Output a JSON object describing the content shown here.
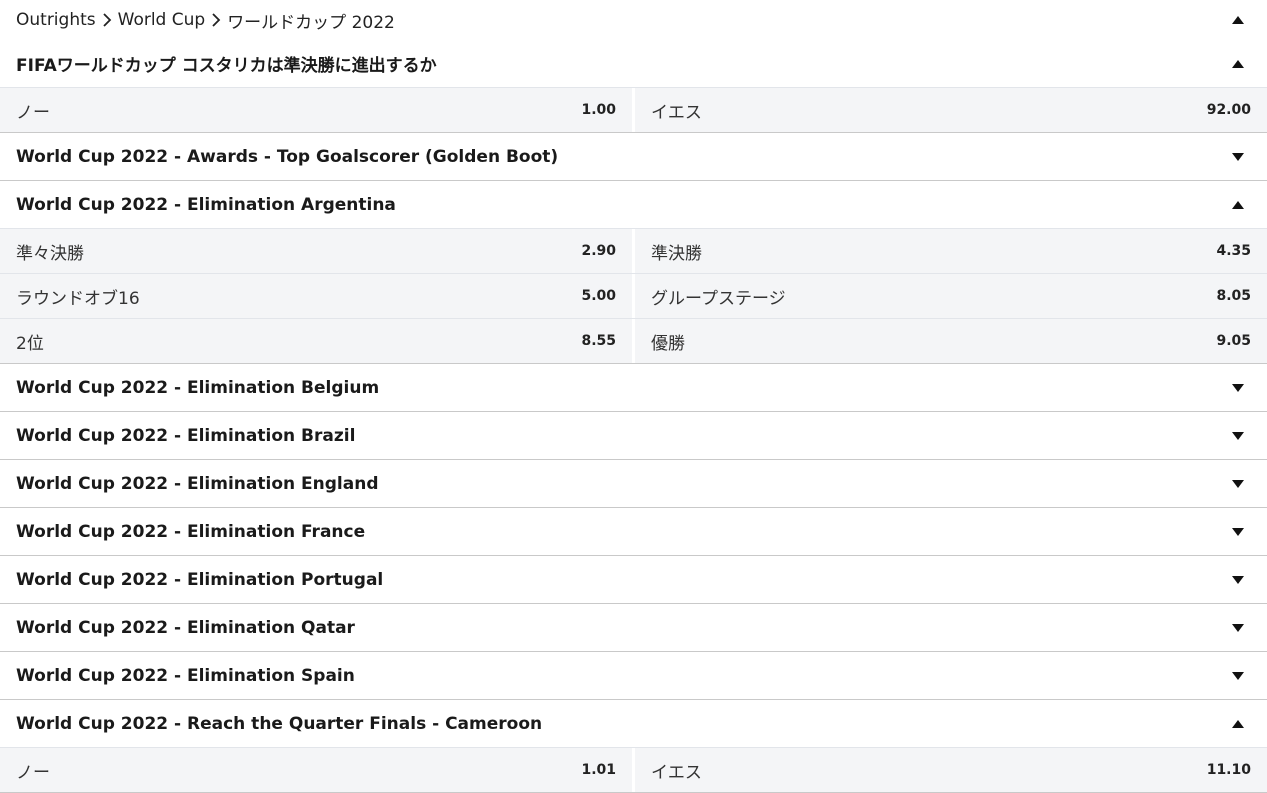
{
  "breadcrumb": {
    "items": [
      "Outrights",
      "World Cup",
      "ワールドカップ 2022"
    ]
  },
  "markets": [
    {
      "title": "FIFAワールドカップ コスタリカは準決勝に進出するか",
      "expanded": true,
      "rows": [
        [
          {
            "name": "ノー",
            "odds": "1.00"
          },
          {
            "name": "イエス",
            "odds": "92.00"
          }
        ]
      ]
    },
    {
      "title": "World Cup 2022 - Awards - Top Goalscorer (Golden Boot)",
      "expanded": false,
      "rows": []
    },
    {
      "title": "World Cup 2022 - Elimination Argentina",
      "expanded": true,
      "rows": [
        [
          {
            "name": "準々決勝",
            "odds": "2.90"
          },
          {
            "name": "準決勝",
            "odds": "4.35"
          }
        ],
        [
          {
            "name": "ラウンドオブ16",
            "odds": "5.00"
          },
          {
            "name": "グループステージ",
            "odds": "8.05"
          }
        ],
        [
          {
            "name": "2位",
            "odds": "8.55"
          },
          {
            "name": "優勝",
            "odds": "9.05"
          }
        ]
      ]
    },
    {
      "title": "World Cup 2022 - Elimination Belgium",
      "expanded": false,
      "rows": []
    },
    {
      "title": "World Cup 2022 - Elimination Brazil",
      "expanded": false,
      "rows": []
    },
    {
      "title": "World Cup 2022 - Elimination England",
      "expanded": false,
      "rows": []
    },
    {
      "title": "World Cup 2022 - Elimination France",
      "expanded": false,
      "rows": []
    },
    {
      "title": "World Cup 2022 - Elimination Portugal",
      "expanded": false,
      "rows": []
    },
    {
      "title": "World Cup 2022 - Elimination Qatar",
      "expanded": false,
      "rows": []
    },
    {
      "title": "World Cup 2022 - Elimination Spain",
      "expanded": false,
      "rows": []
    },
    {
      "title": "World Cup 2022 - Reach the Quarter Finals - Cameroon",
      "expanded": true,
      "rows": [
        [
          {
            "name": "ノー",
            "odds": "1.01"
          },
          {
            "name": "イエス",
            "odds": "11.10"
          }
        ]
      ]
    }
  ],
  "icons": {
    "expanded": "triangle-up-icon",
    "collapsed": "triangle-down-icon",
    "separator": "chevron-right-icon"
  },
  "colors": {
    "selection_bg": "#f4f5f7",
    "divider": "#c9c9c9"
  }
}
